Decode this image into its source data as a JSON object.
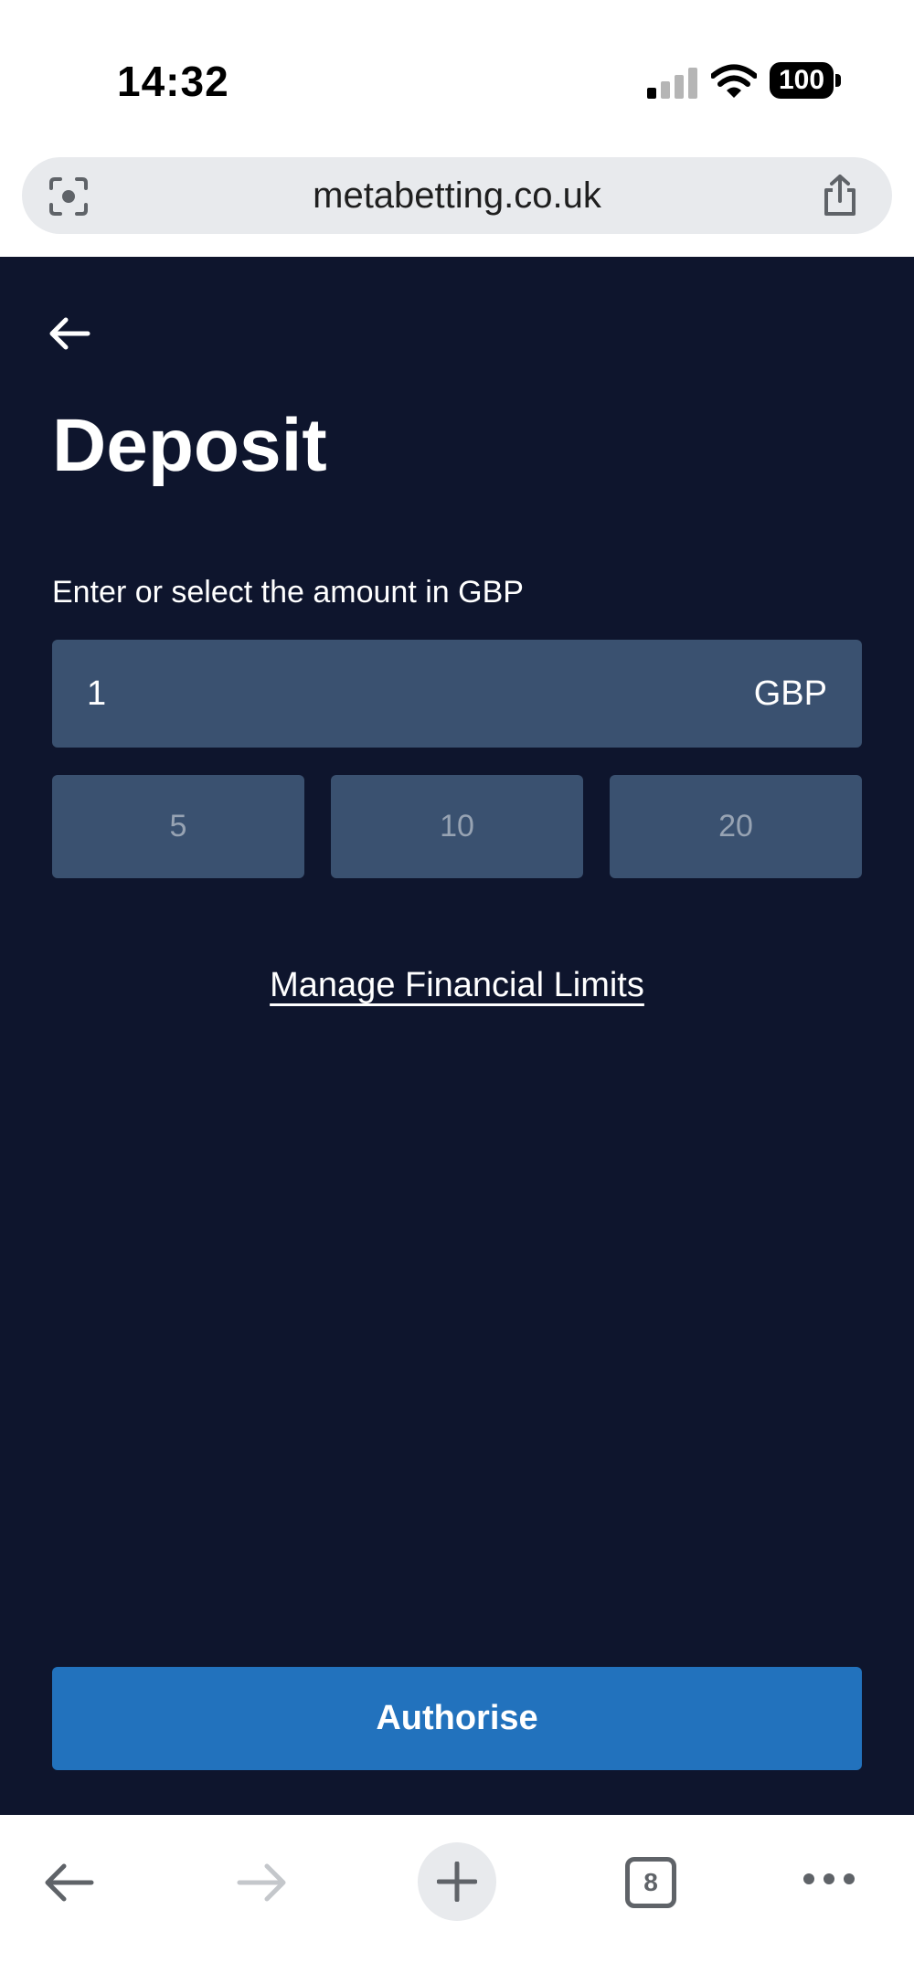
{
  "status_bar": {
    "time": "14:32",
    "battery": "100",
    "icons": [
      "signal-icon",
      "wifi-icon",
      "battery-icon"
    ]
  },
  "browser": {
    "url": "metabetting.co.uk",
    "icons": [
      "lens-icon",
      "share-icon"
    ]
  },
  "page": {
    "title": "Deposit",
    "amount_label": "Enter or select the amount in GBP",
    "amount_value": "1",
    "currency": "GBP",
    "presets": [
      "5",
      "10",
      "20"
    ],
    "limits_link": "Manage Financial Limits",
    "authorise_label": "Authorise"
  },
  "toolbar": {
    "tab_count": "8",
    "icons": [
      "back-icon",
      "forward-icon",
      "new-tab-icon",
      "tabs-icon",
      "more-icon"
    ]
  },
  "colors": {
    "background": "#0e152d",
    "field": "#3a5170",
    "accent": "#2272bd"
  }
}
